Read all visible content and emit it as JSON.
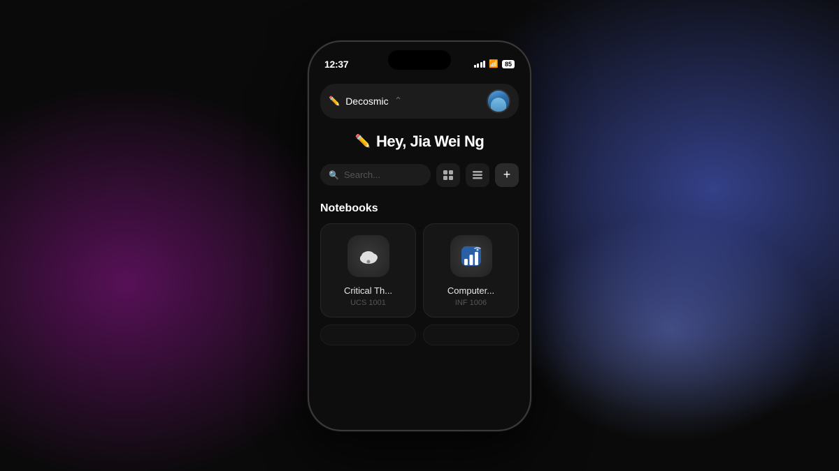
{
  "background": {
    "colors": [
      "#0a0a0a",
      "#5a1a6a",
      "#3050c0",
      "#7080d0"
    ]
  },
  "statusBar": {
    "time": "12:37",
    "batteryLevel": "85",
    "icons": [
      "signal",
      "wifi",
      "battery"
    ]
  },
  "workspace": {
    "name": "Decosmic",
    "icon": "✏️",
    "chevron": "⌃"
  },
  "greeting": {
    "icon": "✏️",
    "text": "Hey, Jia Wei Ng"
  },
  "search": {
    "placeholder": "Search..."
  },
  "sections": {
    "notebooks": {
      "title": "Notebooks",
      "items": [
        {
          "title": "Critical Th...",
          "subtitle": "UCS 1001",
          "icon": "cloud"
        },
        {
          "title": "Computer...",
          "subtitle": "INF 1006",
          "icon": "chart"
        }
      ]
    }
  },
  "buttons": {
    "add": "+",
    "gridView": "⊞",
    "listView": "☰"
  }
}
